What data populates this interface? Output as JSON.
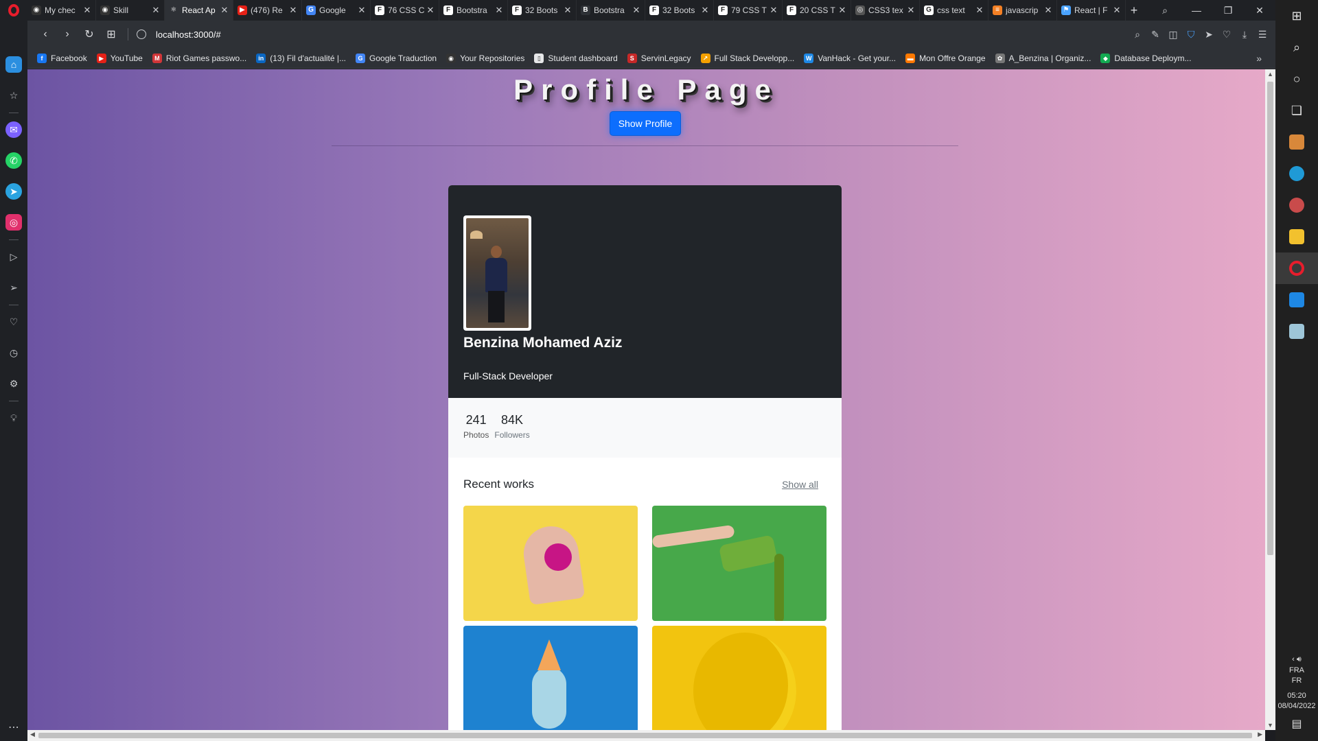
{
  "browser": {
    "tabs": [
      {
        "title": "My chec",
        "color": "#333333",
        "glyph": "◉"
      },
      {
        "title": "Skill",
        "color": "#333333",
        "glyph": "◉"
      },
      {
        "title": "React Ap",
        "color": "#2e3136",
        "glyph": "⚛",
        "active": true
      },
      {
        "title": "(476) Re",
        "color": "#e62117",
        "glyph": "▶"
      },
      {
        "title": "Google",
        "color": "#4285f4",
        "glyph": "G"
      },
      {
        "title": "76 CSS C",
        "color": "#ffffff",
        "glyph": "F"
      },
      {
        "title": "Bootstra",
        "color": "#ffffff",
        "glyph": "F"
      },
      {
        "title": "32 Boots",
        "color": "#ffffff",
        "glyph": "F"
      },
      {
        "title": "Bootstra",
        "color": "#2e3136",
        "glyph": "B"
      },
      {
        "title": "32 Boots",
        "color": "#ffffff",
        "glyph": "F"
      },
      {
        "title": "79 CSS T",
        "color": "#ffffff",
        "glyph": "F"
      },
      {
        "title": "20 CSS T",
        "color": "#ffffff",
        "glyph": "F"
      },
      {
        "title": "CSS3 tex",
        "color": "#555555",
        "glyph": "◎"
      },
      {
        "title": "css text",
        "color": "#ffffff",
        "glyph": "G"
      },
      {
        "title": "javascrip",
        "color": "#f48024",
        "glyph": "≡"
      },
      {
        "title": "React | F",
        "color": "#4aa3ff",
        "glyph": "⚑"
      }
    ],
    "url": "localhost:3000/#",
    "bookmarks": [
      {
        "label": "Facebook",
        "color": "#1877f2",
        "glyph": "f"
      },
      {
        "label": "YouTube",
        "color": "#e62117",
        "glyph": "▶"
      },
      {
        "label": "Riot Games passwo...",
        "color": "#d13639",
        "glyph": "M"
      },
      {
        "label": "(13) Fil d'actualité |...",
        "color": "#0a66c2",
        "glyph": "in"
      },
      {
        "label": "Google Traduction",
        "color": "#4285f4",
        "glyph": "G"
      },
      {
        "label": "Your Repositories",
        "color": "#333333",
        "glyph": "◉"
      },
      {
        "label": "Student dashboard",
        "color": "#e6e7e9",
        "glyph": "▯"
      },
      {
        "label": "ServinLegacy",
        "color": "#c62828",
        "glyph": "S"
      },
      {
        "label": "Full Stack Developp...",
        "color": "#f4a000",
        "glyph": "↗"
      },
      {
        "label": "VanHack - Get your...",
        "color": "#1e88e5",
        "glyph": "W"
      },
      {
        "label": "Mon Offre Orange",
        "color": "#ff7900",
        "glyph": "▬"
      },
      {
        "label": "A_Benzina | Organiz...",
        "color": "#777777",
        "glyph": "✿"
      },
      {
        "label": "Database Deploym...",
        "color": "#13aa52",
        "glyph": "◆"
      }
    ]
  },
  "page": {
    "title": "Profile Page",
    "show_button": "Show Profile",
    "profile": {
      "name": "Benzina Mohamed Aziz",
      "role": "Full-Stack Developer"
    },
    "stats": [
      {
        "value": "241",
        "label": "Photos"
      },
      {
        "value": "84K",
        "label": "Followers"
      }
    ],
    "recent": {
      "title": "Recent works",
      "show_all": "Show all"
    }
  },
  "taskbar": {
    "lang1": "FRA",
    "lang2": "FR",
    "time": "05:20",
    "date": "08/04/2022"
  }
}
